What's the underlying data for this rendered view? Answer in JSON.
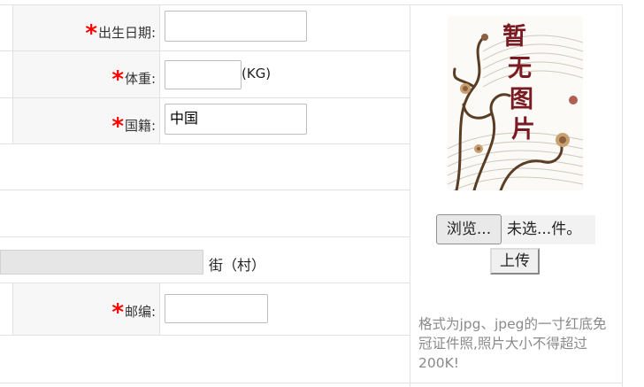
{
  "form": {
    "birthdate": {
      "label": "出生日期:",
      "value": ""
    },
    "weight": {
      "label": "体重:",
      "value": "",
      "unit": "(KG)"
    },
    "nationality": {
      "label": "国籍:",
      "value": "中国"
    },
    "street": {
      "value": "",
      "suffix": "街（村）"
    },
    "postcode": {
      "label": "邮编:",
      "value": ""
    },
    "required_mark": "*"
  },
  "photo": {
    "placeholder_text": "暂无图片",
    "browse_label": "浏览...",
    "file_status": "未选...件。",
    "upload_label": "上传",
    "note": "格式为jpg、jpeg的一寸红底免冠证件照,照片大小不得超过200K!"
  }
}
